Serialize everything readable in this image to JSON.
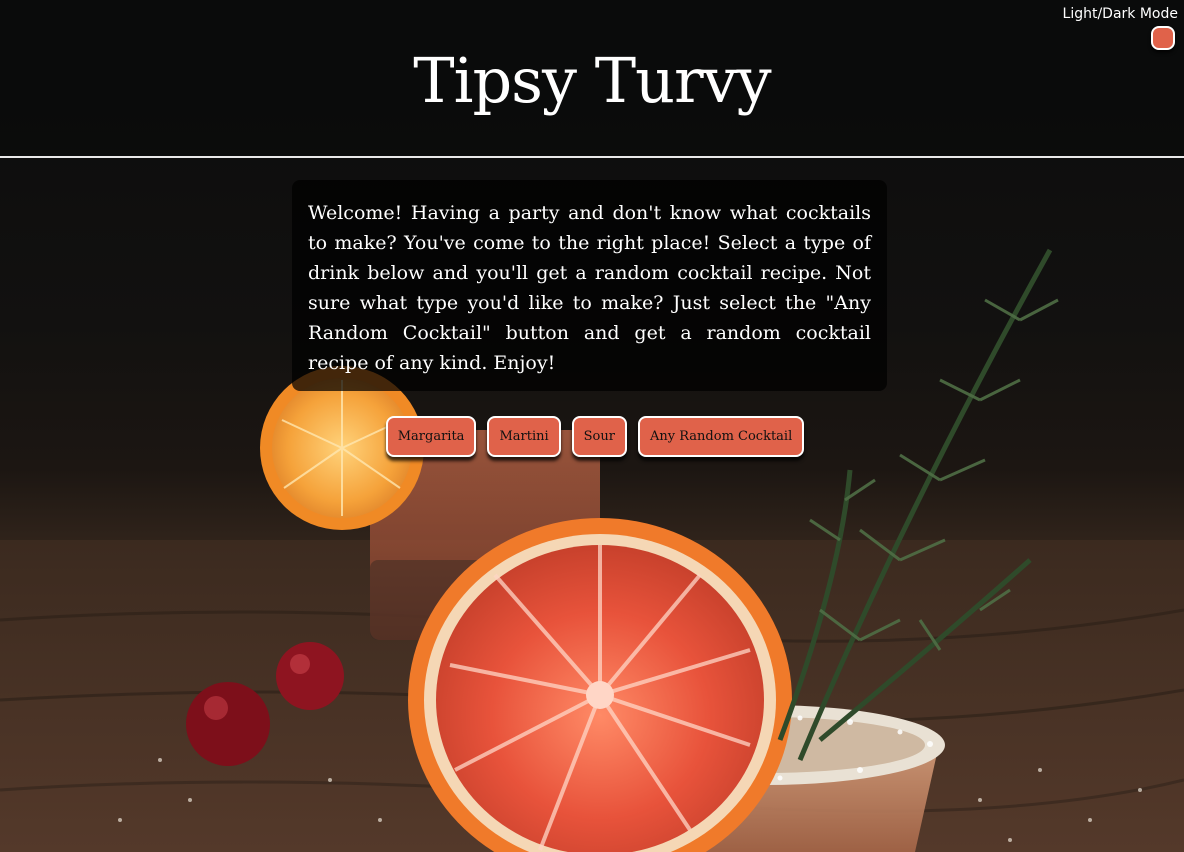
{
  "header": {
    "title": "Tipsy Turvy",
    "mode_toggle_label": "Light/Dark Mode"
  },
  "intro": {
    "text": "Welcome! Having a party and don't know what cocktails to make? You've come to the right place! Select a type of drink below and you'll get a random cocktail recipe. Not sure what type you'd like to make? Just select the \"Any Random Cocktail\" button and get a random cocktail recipe of any kind. Enjoy!"
  },
  "buttons": {
    "margarita": "Margarita",
    "martini": "Martini",
    "sour": "Sour",
    "random": "Any Random Cocktail"
  },
  "colors": {
    "accent": "#e0624a",
    "header_bg": "#0a0b0c",
    "text": "#ffffff"
  }
}
